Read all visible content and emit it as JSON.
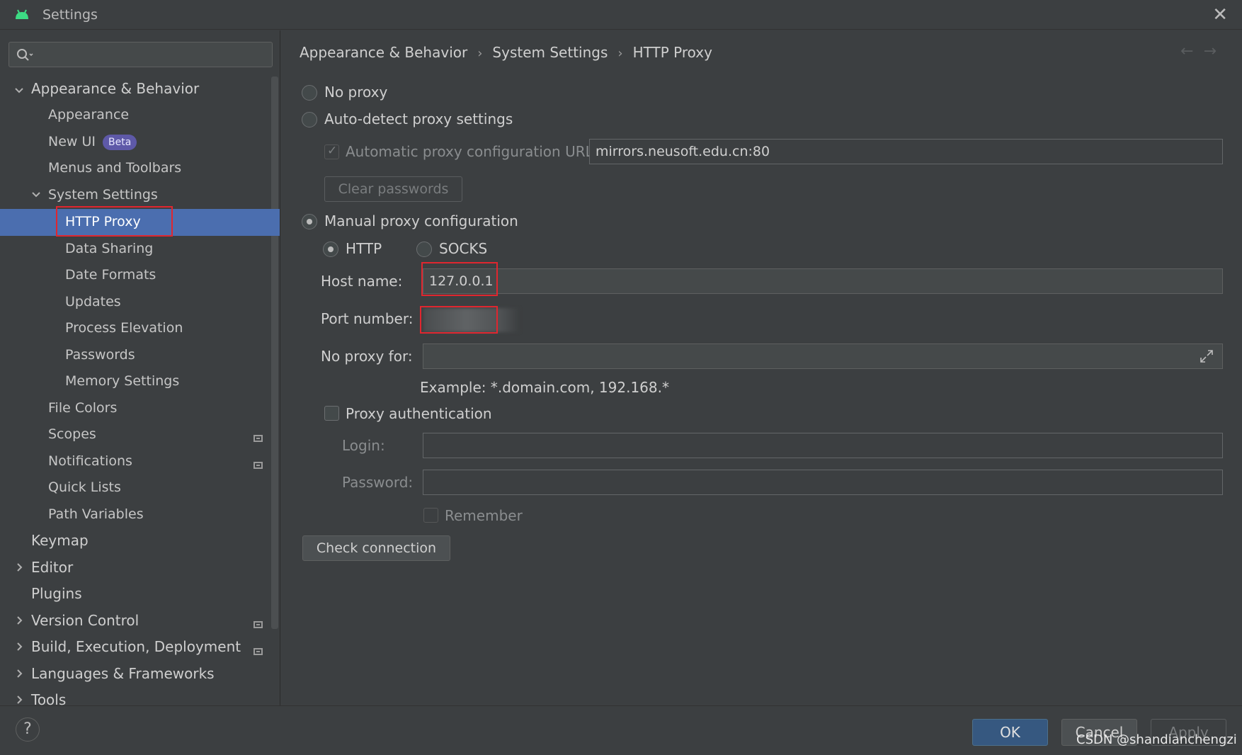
{
  "window": {
    "title": "Settings",
    "close_icon": "close-icon"
  },
  "sidebar": {
    "search_placeholder": "",
    "items": [
      {
        "label": "Appearance & Behavior",
        "expanded": true
      },
      {
        "label": "Appearance"
      },
      {
        "label": "New UI",
        "badge": "Beta"
      },
      {
        "label": "Menus and Toolbars"
      },
      {
        "label": "System Settings",
        "expanded": true
      },
      {
        "label": "HTTP Proxy",
        "selected": true
      },
      {
        "label": "Data Sharing"
      },
      {
        "label": "Date Formats"
      },
      {
        "label": "Updates"
      },
      {
        "label": "Process Elevation"
      },
      {
        "label": "Passwords"
      },
      {
        "label": "Memory Settings"
      },
      {
        "label": "File Colors"
      },
      {
        "label": "Scopes"
      },
      {
        "label": "Notifications"
      },
      {
        "label": "Quick Lists"
      },
      {
        "label": "Path Variables"
      },
      {
        "label": "Keymap"
      },
      {
        "label": "Editor"
      },
      {
        "label": "Plugins"
      },
      {
        "label": "Version Control"
      },
      {
        "label": "Build, Execution, Deployment"
      },
      {
        "label": "Languages & Frameworks"
      },
      {
        "label": "Tools"
      }
    ]
  },
  "breadcrumb": {
    "items": [
      "Appearance & Behavior",
      "System Settings",
      "HTTP Proxy"
    ],
    "separator": "›"
  },
  "proxy": {
    "no_proxy": "No proxy",
    "auto_detect": "Auto-detect proxy settings",
    "auto_url_label": "Automatic proxy configuration URL:",
    "auto_url_value": "mirrors.neusoft.edu.cn:80",
    "clear_passwords": "Clear passwords",
    "manual": "Manual proxy configuration",
    "http": "HTTP",
    "socks": "SOCKS",
    "host_label": "Host name:",
    "host_value": "127.0.0.1",
    "port_label": "Port number:",
    "port_value": "",
    "no_proxy_for_label": "No proxy for:",
    "no_proxy_for_value": "",
    "example": "Example: *.domain.com, 192.168.*",
    "proxy_auth": "Proxy authentication",
    "login_label": "Login:",
    "password_label": "Password:",
    "remember": "Remember",
    "check_connection": "Check connection"
  },
  "footer": {
    "help": "?",
    "ok": "OK",
    "cancel": "Cancel",
    "apply": "Apply",
    "watermark": "CSDN @shandianchengzi"
  },
  "colors": {
    "background": "#3c3f41",
    "selection": "#4b6eaf",
    "ok_button": "#365880",
    "highlight_box": "#e0262f",
    "beta_badge": "#5e59a8"
  }
}
